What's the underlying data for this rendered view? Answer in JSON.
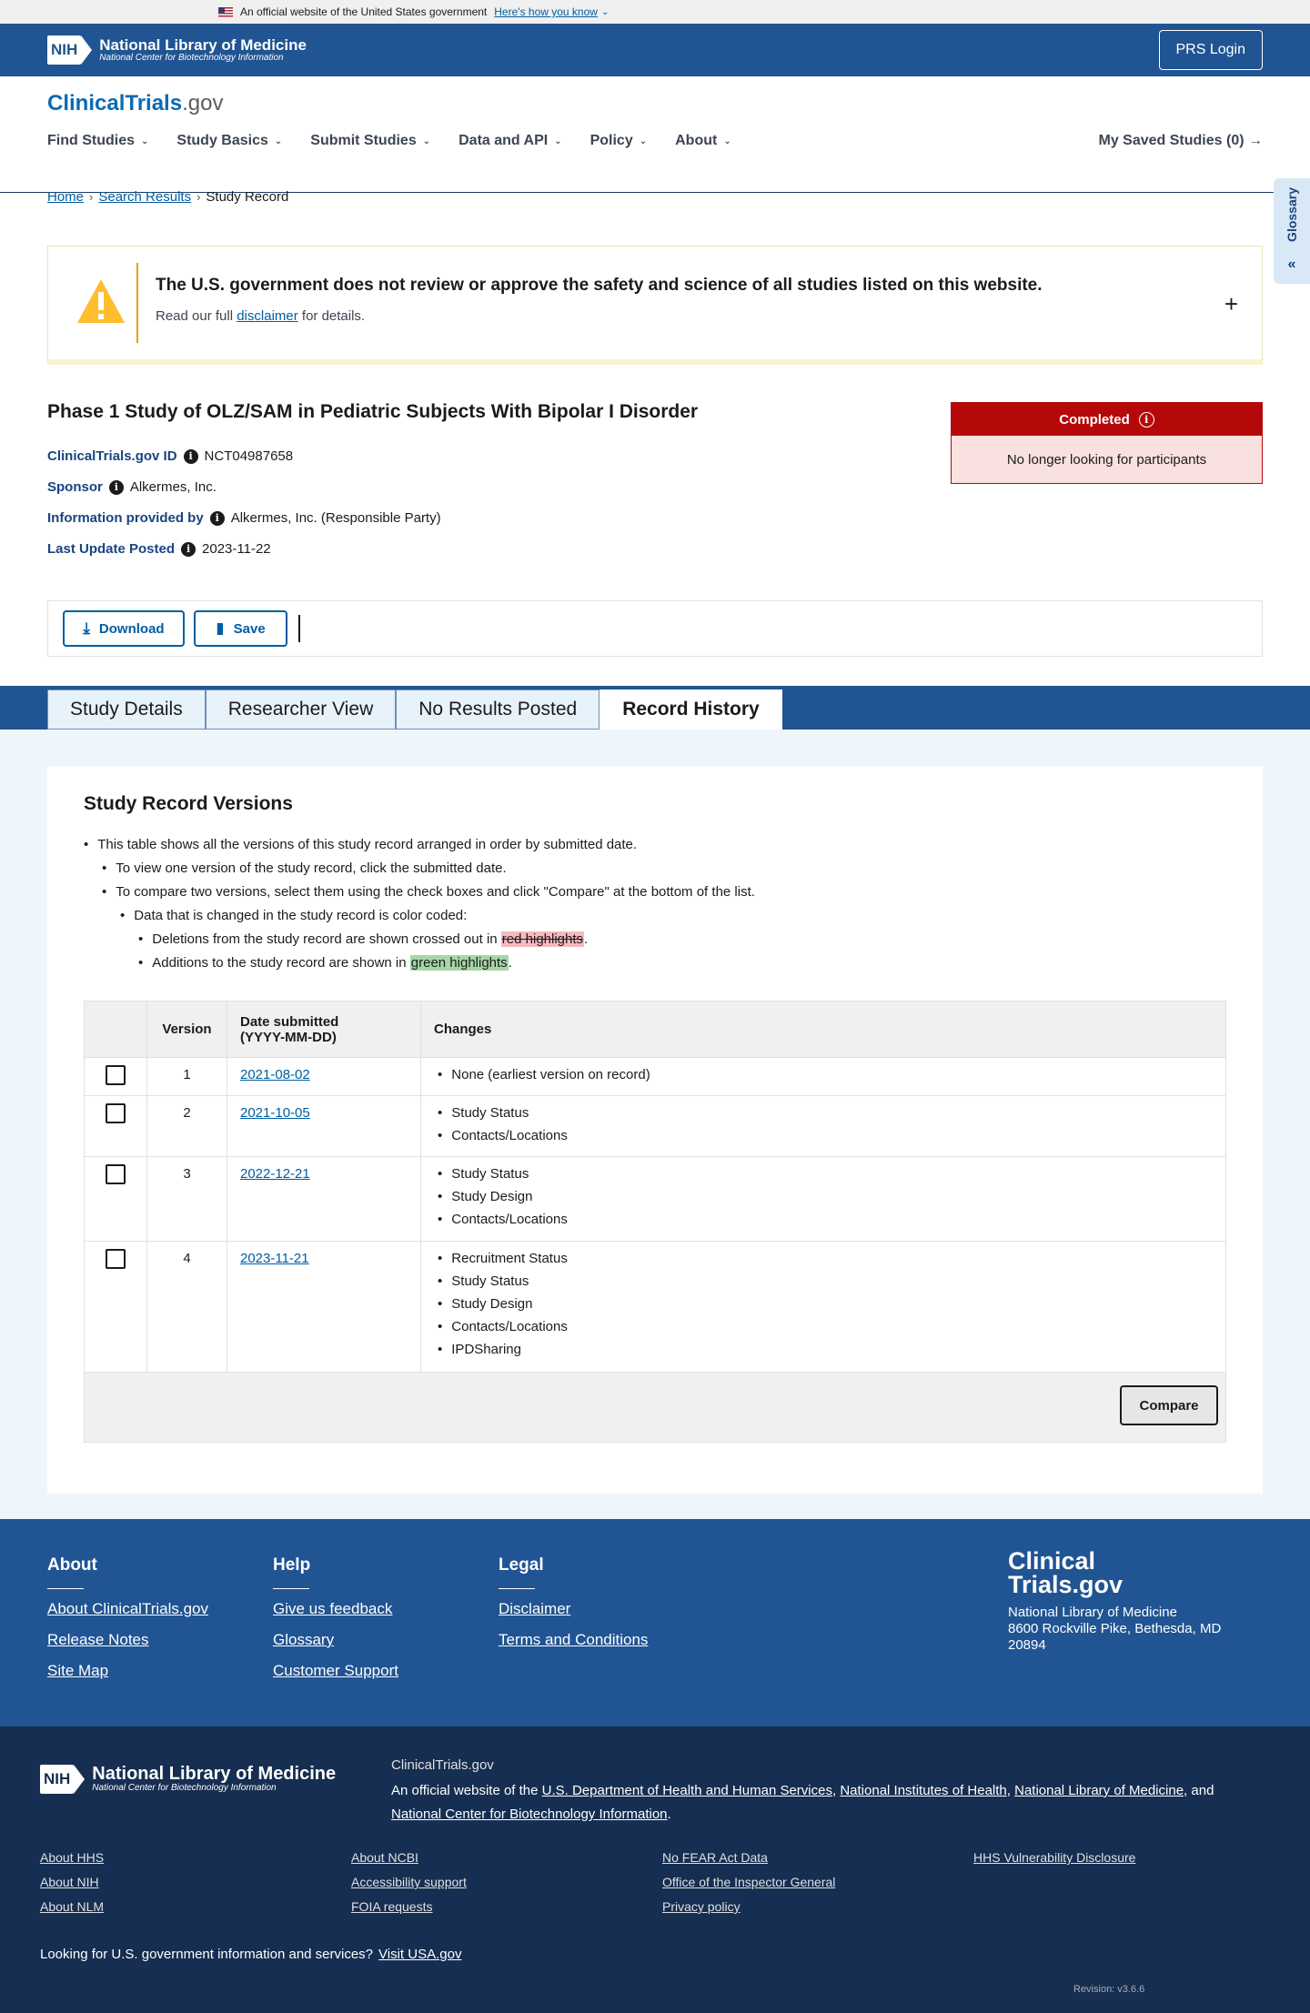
{
  "gov_banner": {
    "text": "An official website of the United States government",
    "link": "Here's how you know"
  },
  "nih_header": {
    "logo_box": "NIH",
    "logo_title": "National Library of Medicine",
    "logo_subtitle": "National Center for Biotechnology Information",
    "prs_login": "PRS Login"
  },
  "site": {
    "logo_main": "ClinicalTrials",
    "logo_suffix": ".gov",
    "nav": [
      "Find Studies",
      "Study Basics",
      "Submit Studies",
      "Data and API",
      "Policy",
      "About"
    ],
    "saved_studies": "My Saved Studies (0) →"
  },
  "breadcrumb": {
    "home": "Home",
    "search": "Search Results",
    "current": "Study Record"
  },
  "glossary": {
    "label": "Glossary"
  },
  "disclaimer": {
    "title": "The U.S. government does not review or approve the safety and science of all studies listed on this website.",
    "prefix": "Read our full ",
    "link": "disclaimer",
    "suffix": " for details."
  },
  "study": {
    "title": "Phase 1 Study of OLZ/SAM in Pediatric Subjects With Bipolar I Disorder",
    "id_label": "ClinicalTrials.gov ID",
    "id_value": "NCT04987658",
    "sponsor_label": "Sponsor",
    "sponsor_value": "Alkermes, Inc.",
    "info_label": "Information provided by",
    "info_value": "Alkermes, Inc. (Responsible Party)",
    "updated_label": "Last Update Posted",
    "updated_value": "2023-11-22",
    "status": "Completed",
    "status_detail": "No longer looking for participants"
  },
  "actions": {
    "download": "Download",
    "save": "Save"
  },
  "tabs": [
    "Study Details",
    "Researcher View",
    "No Results Posted",
    "Record History"
  ],
  "versions": {
    "heading": "Study Record Versions",
    "bullet1": "This table shows all the versions of this study record arranged in order by submitted date.",
    "bullet2": "To view one version of the study record, click the submitted date.",
    "bullet3": "To compare two versions, select them using the check boxes and click \"Compare\" at the bottom of the list.",
    "bullet4": "Data that is changed in the study record is color coded:",
    "bullet5_prefix": "Deletions from the study record are shown crossed out in ",
    "bullet5_hl": "red highlights",
    "bullet6_prefix": "Additions to the study record are shown in ",
    "bullet6_hl": "green highlights",
    "period": ".",
    "columns": {
      "version": "Version",
      "date_line1": "Date submitted",
      "date_line2": "(YYYY-MM-DD)",
      "changes": "Changes"
    },
    "rows": [
      {
        "version": "1",
        "date": "2021-08-02",
        "changes": [
          "None (earliest version on record)"
        ]
      },
      {
        "version": "2",
        "date": "2021-10-05",
        "changes": [
          "Study Status",
          "Contacts/Locations"
        ]
      },
      {
        "version": "3",
        "date": "2022-12-21",
        "changes": [
          "Study Status",
          "Study Design",
          "Contacts/Locations"
        ]
      },
      {
        "version": "4",
        "date": "2023-11-21",
        "changes": [
          "Recruitment Status",
          "Study Status",
          "Study Design",
          "Contacts/Locations",
          "IPDSharing"
        ]
      }
    ],
    "compare": "Compare"
  },
  "footer": {
    "about_heading": "About",
    "about_links": [
      "About ClinicalTrials.gov",
      "Release Notes",
      "Site Map"
    ],
    "help_heading": "Help",
    "help_links": [
      "Give us feedback",
      "Glossary",
      "Customer Support"
    ],
    "legal_heading": "Legal",
    "legal_links": [
      "Disclaimer",
      "Terms and Conditions"
    ],
    "logo_line1": "Clinical",
    "logo_line2": "Trials.gov",
    "address_line1": "National Library of Medicine",
    "address_line2": "8600 Rockville Pike, Bethesda, MD 20894"
  },
  "footer2": {
    "site_name": "ClinicalTrials.gov",
    "official_prefix": "An official website of the ",
    "hhs": "U.S. Department of Health and Human Services",
    "nih": "National Institutes of Health",
    "nlm": "National Library of Medicine",
    "and": "and ",
    "ncbi": "National Center for Biotechnology Information",
    "col1": [
      "About HHS",
      "About NIH",
      "About NLM"
    ],
    "col2": [
      "About NCBI",
      "Accessibility support",
      "FOIA requests"
    ],
    "col3": [
      "No FEAR Act Data",
      "Office of the Inspector General",
      "Privacy policy"
    ],
    "col4": [
      "HHS Vulnerability Disclosure"
    ],
    "usa_prefix": "Looking for U.S. government information and services?",
    "usa_link": "Visit USA.gov",
    "revision": "Revision: v3.6.6"
  }
}
